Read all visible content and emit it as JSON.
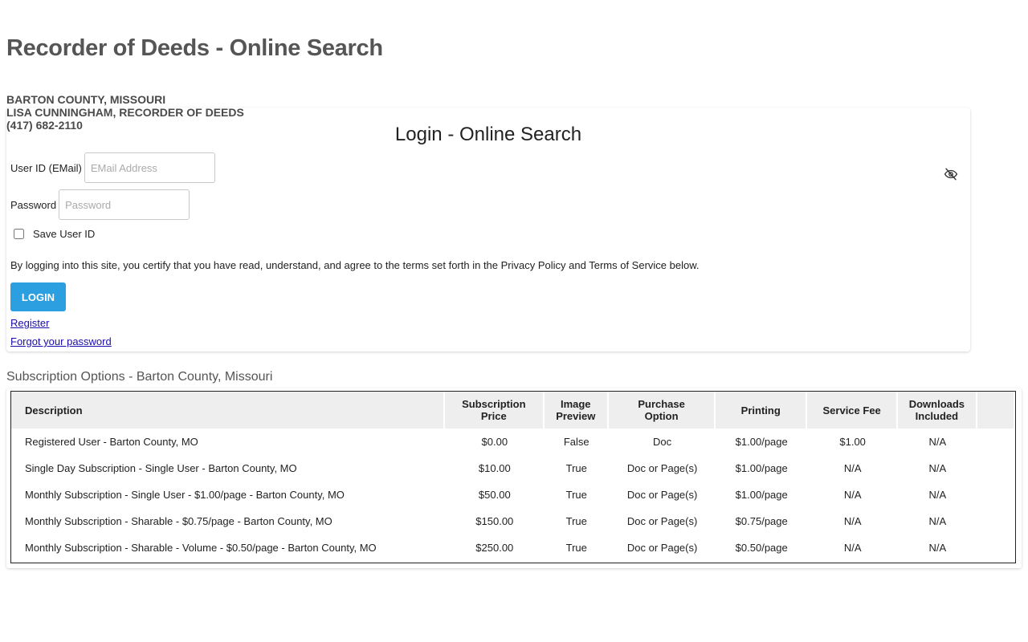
{
  "header": {
    "site_title": "Recorder of Deeds - Online Search",
    "county_lines": [
      "BARTON COUNTY, MISSOURI",
      "LISA CUNNINGHAM, RECORDER OF DEEDS",
      "(417) 682-2110"
    ]
  },
  "login": {
    "title": "Login - Online Search",
    "user_label": "User ID (EMail)",
    "user_value": "",
    "user_placeholder": "EMail Address",
    "password_label": "Password",
    "password_value": "",
    "password_placeholder": "Password",
    "password_toggle_icon": "eye-slash-icon",
    "save_user_label": "Save User ID",
    "save_user_checked": false,
    "terms_text": "By logging into this site, you certify that you have read, understand, and agree to the terms set forth in the Privacy Policy and Terms of Service below.",
    "login_button": "LOGIN",
    "register_link": "Register",
    "forgot_link": "Forgot your password",
    "button_color": "#2b9fe0",
    "link_color": "#1a0dab"
  },
  "subscriptions": {
    "title": "Subscription Options - Barton County, Missouri",
    "headers": {
      "description": "Description",
      "price_1": "Subscription",
      "price_2": "Price",
      "image_1": "Image",
      "image_2": "Preview",
      "purchase_1": "Purchase",
      "purchase_2": "Option",
      "printing": "Printing",
      "fee": "Service Fee",
      "downloads_1": "Downloads",
      "downloads_2": "Included"
    },
    "rows": [
      {
        "description": "Registered User - Barton County, MO",
        "price": "$0.00",
        "image_preview": "False",
        "purchase_option": "Doc",
        "printing": "$1.00/page",
        "service_fee": "$1.00",
        "downloads": "N/A"
      },
      {
        "description": "Single Day Subscription - Single User - Barton County, MO",
        "price": "$10.00",
        "image_preview": "True",
        "purchase_option": "Doc or Page(s)",
        "printing": "$1.00/page",
        "service_fee": "N/A",
        "downloads": "N/A"
      },
      {
        "description": "Monthly Subscription - Single User - $1.00/page - Barton County, MO",
        "price": "$50.00",
        "image_preview": "True",
        "purchase_option": "Doc or Page(s)",
        "printing": "$1.00/page",
        "service_fee": "N/A",
        "downloads": "N/A"
      },
      {
        "description": "Monthly Subscription - Sharable - $0.75/page - Barton County, MO",
        "price": "$150.00",
        "image_preview": "True",
        "purchase_option": "Doc or Page(s)",
        "printing": "$0.75/page",
        "service_fee": "N/A",
        "downloads": "N/A"
      },
      {
        "description": "Monthly Subscription - Sharable - Volume - $0.50/page - Barton County, MO",
        "price": "$250.00",
        "image_preview": "True",
        "purchase_option": "Doc or Page(s)",
        "printing": "$0.50/page",
        "service_fee": "N/A",
        "downloads": "N/A"
      }
    ]
  }
}
